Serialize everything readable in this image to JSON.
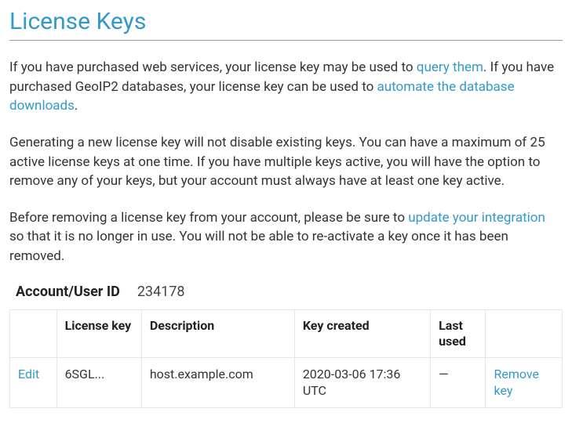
{
  "page": {
    "title": "License Keys"
  },
  "paragraphs": {
    "p1": {
      "part1": "If you have purchased web services, your license key may be used to ",
      "link1": "query them",
      "part2": ". If you have purchased GeoIP2 databases, your license key can be used to ",
      "link2": "automate the database downloads",
      "part3": "."
    },
    "p2": "Generating a new license key will not disable existing keys. You can have a maximum of 25 active license keys at one time. If you have multiple keys active, you will have the option to remove any of your keys, but your account must always have at least one key active.",
    "p3": {
      "part1": "Before removing a license key from your account, please be sure to ",
      "link1": "update your integration",
      "part2": " so that it is no longer in use. You will not be able to re-activate a key once it has been removed."
    }
  },
  "account": {
    "label": "Account/User ID",
    "value": "234178"
  },
  "table": {
    "headers": {
      "edit": "",
      "license_key": "License key",
      "description": "Description",
      "key_created": "Key created",
      "last_used": "Last used",
      "remove": ""
    },
    "rows": [
      {
        "edit_label": "Edit",
        "license_key": "6SGL...",
        "description": "host.example.com",
        "key_created": "2020-03-06 17:36 UTC",
        "last_used": "—",
        "remove_label": "Remove key"
      }
    ]
  }
}
